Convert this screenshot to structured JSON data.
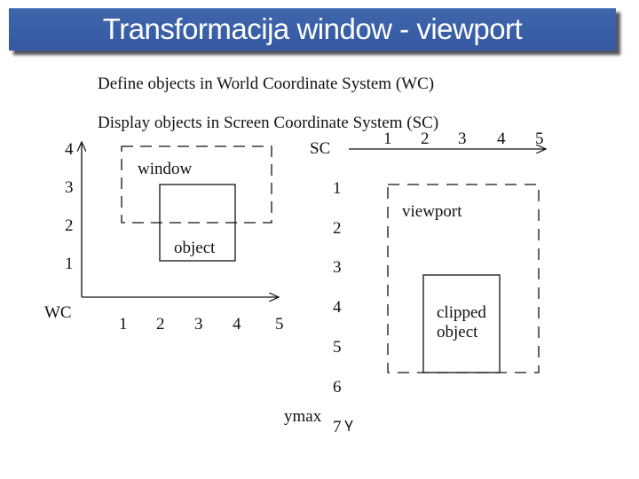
{
  "title": "Transformacija window - viewport",
  "text": {
    "line1": "Define objects in World Coordinate System (WC)",
    "line2": "Display objects in Screen Coordinate System (SC)"
  },
  "wc_diagram": {
    "axis_label": "WC",
    "x_ticks": [
      "1",
      "2",
      "3",
      "4",
      "5"
    ],
    "y_ticks": [
      "1",
      "2",
      "3",
      "4"
    ],
    "window_label": "window",
    "window_rect": {
      "x1": 1,
      "y1": 2,
      "x2": 5,
      "y2": 4
    },
    "object_label": "object",
    "object_rect": {
      "x1": 2,
      "y1": 1,
      "x2": 4,
      "y2": 3
    }
  },
  "sc_diagram": {
    "axis_label": "SC",
    "x_ticks": [
      "1",
      "2",
      "3",
      "4",
      "5"
    ],
    "y_ticks": [
      "1",
      "2",
      "3",
      "4",
      "5",
      "6",
      "7"
    ],
    "y_max_label": "ymax",
    "viewport_label": "viewport",
    "clipped_label_line1": "clipped",
    "clipped_label_line2": "object"
  },
  "colors": {
    "title_bar": "#3a5ea8",
    "title_text": "#ffffff",
    "ink": "#111111"
  }
}
